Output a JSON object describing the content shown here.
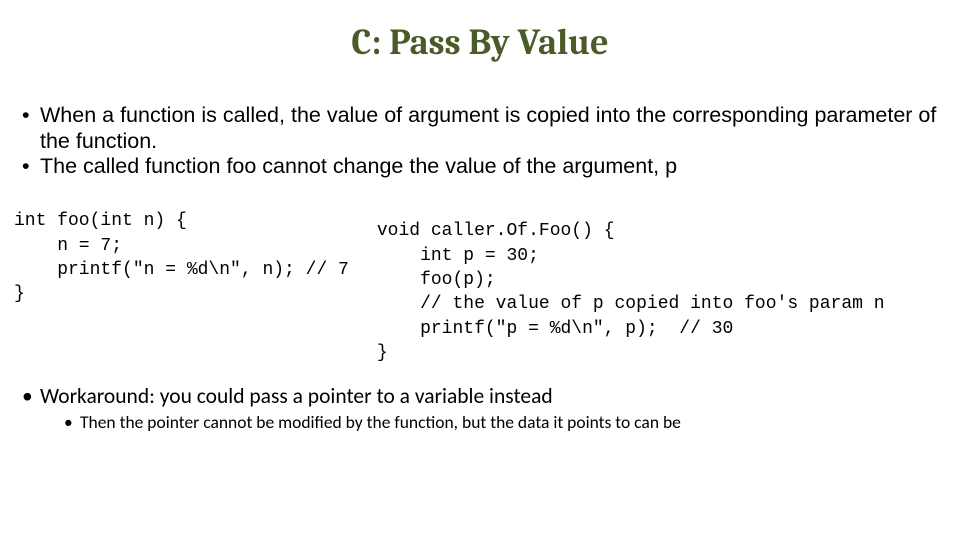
{
  "title": "C: Pass By Value",
  "bullets_top": [
    "When a function is called, the value of argument is copied into the corresponding parameter of the function.",
    "The called function foo cannot change the value of the argument, p"
  ],
  "code_left": "int foo(int n) {\n    n = 7;\n    printf(\"n = %d\\n\", n); // 7\n}",
  "code_right": "void caller.Of.Foo() {\n    int p = 30;\n    foo(p);\n    // the value of p copied into foo's param n\n    printf(\"p = %d\\n\", p);  // 30\n}",
  "bullet_bottom": "Workaround: you could pass a pointer to a variable instead",
  "sub_bullet": "Then the pointer cannot be modified by the function, but the data it points to can be"
}
